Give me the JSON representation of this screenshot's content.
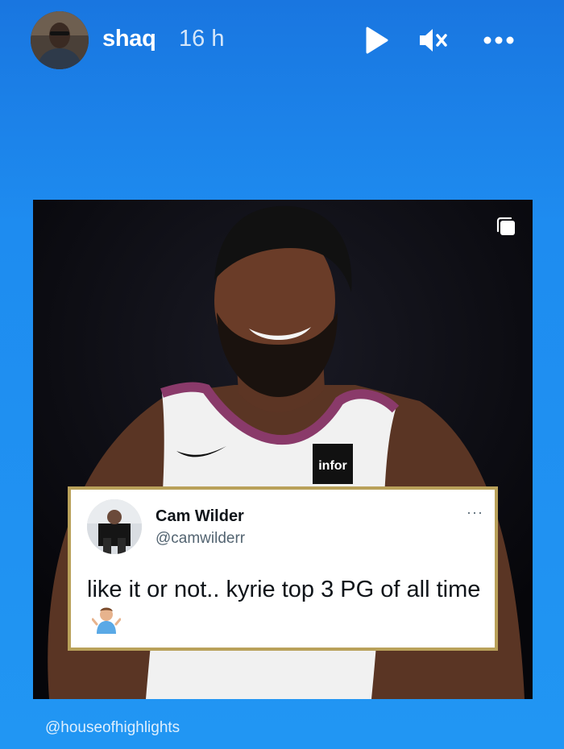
{
  "story": {
    "username": "shaq",
    "timestamp": "16 h",
    "controls": {
      "play_icon": "play-icon",
      "mute_icon": "speaker-muted-icon",
      "more_icon": "more-horizontal-icon"
    },
    "background_color": "#2196f3",
    "source_label": "@houseofhighlights"
  },
  "post": {
    "jersey_sponsor": "infor",
    "carousel_icon": "multiple-posts-icon",
    "tweet": {
      "name": "Cam Wilder",
      "handle": "@camwilderr",
      "more": "···",
      "text": "like it or not.. kyrie top 3 PG of all time",
      "emoji_icon": "person-shrugging-emoji",
      "border_color": "#b9a15a"
    }
  }
}
